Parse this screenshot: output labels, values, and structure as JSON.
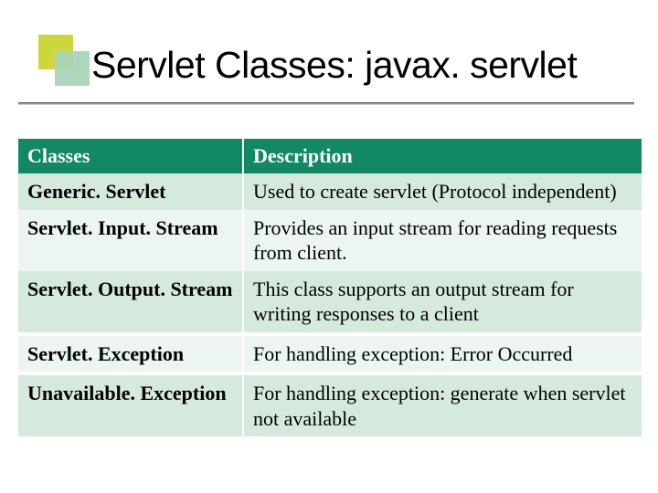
{
  "title": "Servlet Classes: javax. servlet",
  "columns": {
    "c1": "Classes",
    "c2": "Description"
  },
  "rows": [
    {
      "cls": "Generic. Servlet",
      "desc": "Used to create servlet (Protocol independent)"
    },
    {
      "cls": "Servlet. Input. Stream",
      "desc": "Provides an input stream for reading requests from client."
    },
    {
      "cls": "Servlet. Output. Stream",
      "desc": "This class supports an output stream for writing  responses to a client"
    },
    {
      "cls": "Servlet. Exception",
      "desc": "For handling exception: Error Occurred"
    },
    {
      "cls": "Unavailable. Exception",
      "desc": "For handling exception: generate when servlet not available"
    }
  ]
}
